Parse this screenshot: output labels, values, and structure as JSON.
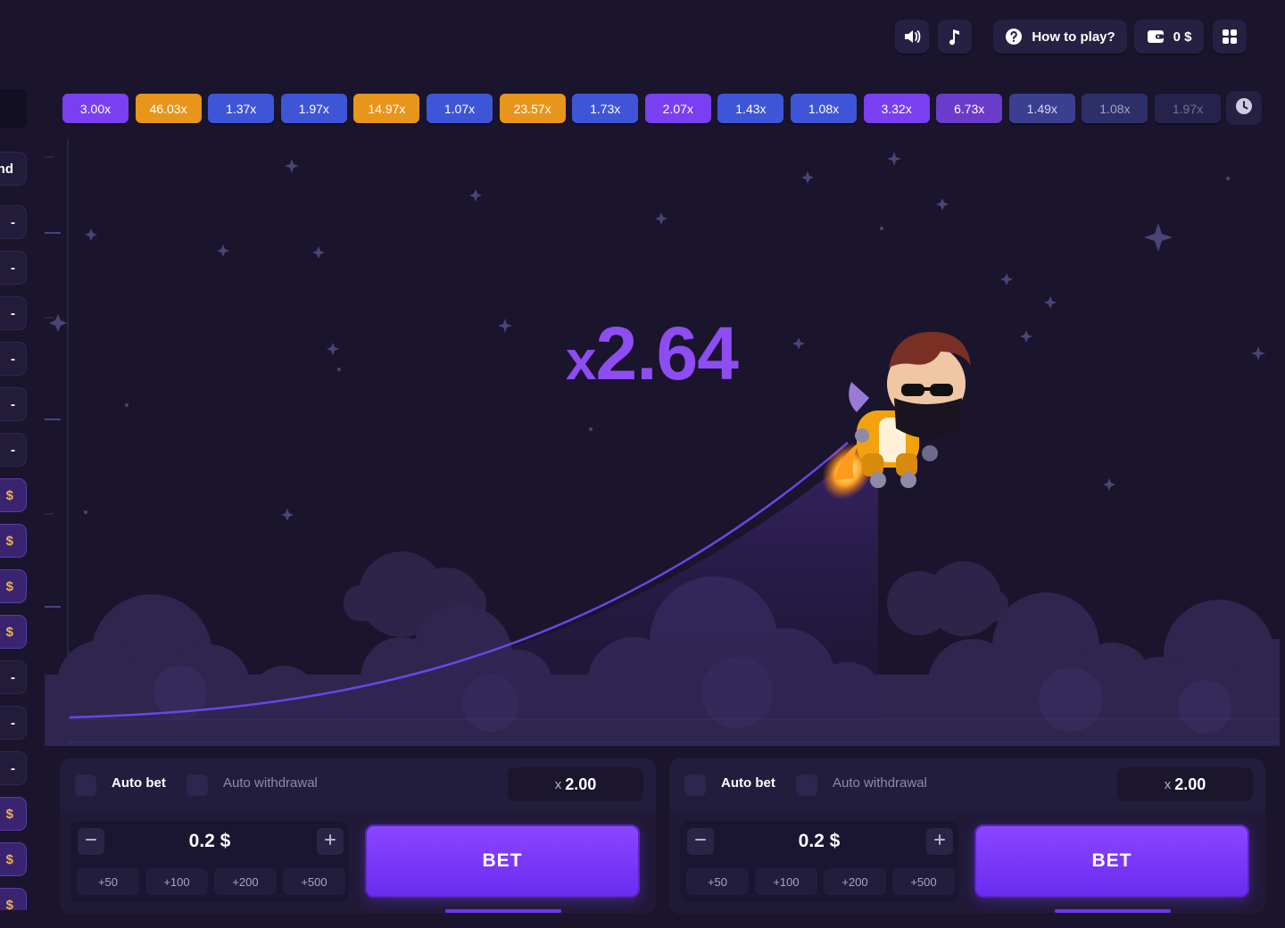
{
  "topbar": {
    "sound_icon": "speaker-icon",
    "music_icon": "music-note-icon",
    "how_to_play_label": "How to play?",
    "help_icon": "question-circle-icon",
    "wallet_icon": "wallet-icon",
    "balance": "0 $",
    "menu_icon": "grid-menu-icon"
  },
  "history": {
    "chips": [
      {
        "label": "3.00x",
        "color": "#7a3ff0"
      },
      {
        "label": "46.03x",
        "color": "#e8951c"
      },
      {
        "label": "1.37x",
        "color": "#3f55d8"
      },
      {
        "label": "1.97x",
        "color": "#3f55d8"
      },
      {
        "label": "14.97x",
        "color": "#e8951c"
      },
      {
        "label": "1.07x",
        "color": "#3f55d8"
      },
      {
        "label": "23.57x",
        "color": "#e8951c"
      },
      {
        "label": "1.73x",
        "color": "#3f55d8"
      },
      {
        "label": "2.07x",
        "color": "#7a3ff0"
      },
      {
        "label": "1.43x",
        "color": "#3f55d8"
      },
      {
        "label": "1.08x",
        "color": "#3f55d8"
      },
      {
        "label": "3.32x",
        "color": "#7a3ff0"
      },
      {
        "label": "6.73x",
        "color": "#6b3bc9"
      },
      {
        "label": "1.49x",
        "color": "#3a3f8f"
      },
      {
        "label": "1.08x",
        "color": "#2e2f68"
      },
      {
        "label": "1.97x",
        "color": "#25234c"
      }
    ],
    "clock_icon": "clock-icon"
  },
  "sidebar": {
    "header": "nd",
    "items": [
      "-",
      "-",
      "-",
      "-",
      "-",
      "-",
      "$",
      "$",
      "$",
      "$",
      "-",
      "-",
      "-",
      "$",
      "$",
      "$"
    ]
  },
  "game": {
    "multiplier_prefix": "x",
    "multiplier_value": "2.64",
    "character": "jetpack-pilot"
  },
  "panels": [
    {
      "auto_bet": "Auto bet",
      "auto_withdrawal": "Auto withdrawal",
      "cashout_prefix": "x",
      "cashout_value": "2.00",
      "amount": "0.2 $",
      "quick": [
        "+50",
        "+100",
        "+200",
        "+500"
      ],
      "bet_label": "BET"
    },
    {
      "auto_bet": "Auto bet",
      "auto_withdrawal": "Auto withdrawal",
      "cashout_prefix": "x",
      "cashout_value": "2.00",
      "amount": "0.2 $",
      "quick": [
        "+50",
        "+100",
        "+200",
        "+500"
      ],
      "bet_label": "BET"
    }
  ],
  "colors": {
    "background": "#1a142d",
    "accent": "#8d4df2",
    "bet_button": "#7a3ff8",
    "win": "#f2b248"
  }
}
